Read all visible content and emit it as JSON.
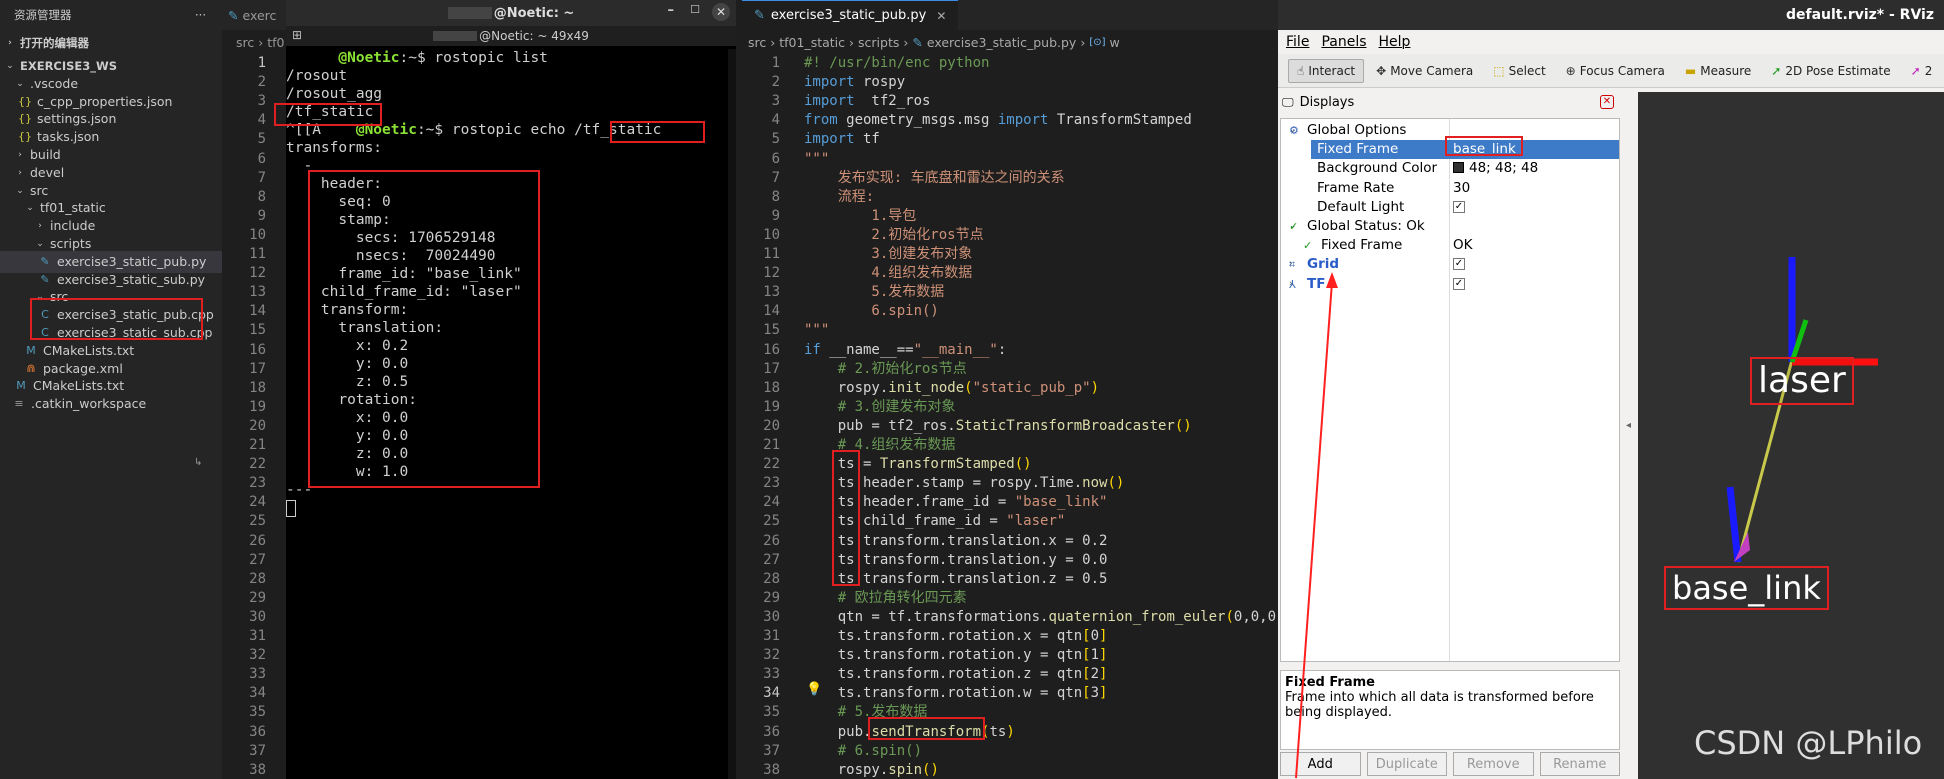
{
  "explorer": {
    "title": "资源管理器",
    "more": "···",
    "open_editors": "打开的编辑器",
    "items": [
      {
        "label": "EXERCISE3_WS",
        "chev": "⌄",
        "icon": "",
        "bold": true
      },
      {
        "label": ".vscode",
        "chev": "⌄",
        "icon": ""
      },
      {
        "label": "c_cpp_properties.json",
        "chev": "",
        "icon": "{}"
      },
      {
        "label": "settings.json",
        "chev": "",
        "icon": "{}"
      },
      {
        "label": "tasks.json",
        "chev": "",
        "icon": "{}"
      },
      {
        "label": "build",
        "chev": "›",
        "icon": ""
      },
      {
        "label": "devel",
        "chev": "›",
        "icon": ""
      },
      {
        "label": "src",
        "chev": "⌄",
        "icon": ""
      },
      {
        "label": "tf01_static",
        "chev": "⌄",
        "icon": ""
      },
      {
        "label": "include",
        "chev": "›",
        "icon": ""
      },
      {
        "label": "scripts",
        "chev": "⌄",
        "icon": ""
      },
      {
        "label": "exercise3_static_pub.py",
        "chev": "",
        "icon": "py",
        "selected": true
      },
      {
        "label": "exercise3_static_sub.py",
        "chev": "",
        "icon": "py"
      },
      {
        "label": "src",
        "chev": "⌄",
        "icon": ""
      },
      {
        "label": "exercise3_static_pub.cpp",
        "chev": "",
        "icon": "C"
      },
      {
        "label": "exercise3_static_sub.cpp",
        "chev": "",
        "icon": "C"
      },
      {
        "label": "CMakeLists.txt",
        "chev": "",
        "icon": "M"
      },
      {
        "label": "package.xml",
        "chev": "",
        "icon": "rss"
      },
      {
        "label": "CMakeLists.txt",
        "chev": "",
        "icon": "M"
      },
      {
        "label": ".catkin_workspace",
        "chev": "",
        "icon": "≡"
      }
    ]
  },
  "left_editor": {
    "tab": "exerc",
    "crumbs": "src › tf0",
    "line_numbers": [
      "1",
      "2",
      "3",
      "4",
      "5",
      "6",
      "7",
      "8",
      "9",
      "10",
      "11",
      "12",
      "13",
      "14",
      "15",
      "16",
      "17",
      "18",
      "19",
      "20",
      "21",
      "22",
      "23",
      "24",
      "25",
      "26",
      "27",
      "28",
      "29",
      "30",
      "31",
      "32",
      "33",
      "34",
      "35",
      "36",
      "37",
      "38"
    ]
  },
  "terminal": {
    "title": "@Noetic: ~",
    "subtitle": "@Noetic: ~ 49x49",
    "lines": [
      {
        "prompt": "@Noetic",
        "rest": ":~$ rostopic list"
      },
      {
        "text": "/rosout"
      },
      {
        "text": "/rosout_agg"
      },
      {
        "text": "/tf_static"
      },
      {
        "prefix": "^[[A    ",
        "prompt": "@Noetic",
        "rest": ":~$ rostopic echo /tf_static"
      },
      {
        "text": "transforms:"
      },
      {
        "text": "  -"
      },
      {
        "text": "    header:"
      },
      {
        "text": "      seq: 0"
      },
      {
        "text": "      stamp:"
      },
      {
        "text": "        secs: 1706529148"
      },
      {
        "text": "        nsecs:  70024490"
      },
      {
        "text": "      frame_id: \"base_link\""
      },
      {
        "text": "    child_frame_id: \"laser\""
      },
      {
        "text": "    transform:"
      },
      {
        "text": "      translation:"
      },
      {
        "text": "        x: 0.2"
      },
      {
        "text": "        y: 0.0"
      },
      {
        "text": "        z: 0.5"
      },
      {
        "text": "      rotation:"
      },
      {
        "text": "        x: 0.0"
      },
      {
        "text": "        y: 0.0"
      },
      {
        "text": "        z: 0.0"
      },
      {
        "text": "        w: 1.0"
      },
      {
        "text": "---"
      }
    ]
  },
  "editor": {
    "tab": "exercise3_static_pub.py",
    "breadcrumbs": [
      "src",
      "tf01_static",
      "scripts",
      "exercise3_static_pub.py",
      "w"
    ],
    "current_line": 34,
    "lines": [
      [
        [
          "cm",
          "#! /usr/bin/enc python"
        ]
      ],
      [
        [
          "kw",
          "import"
        ],
        [
          "tx",
          " rospy"
        ]
      ],
      [
        [
          "kw",
          "import"
        ],
        [
          "tx",
          "  tf2_ros"
        ]
      ],
      [
        [
          "kw",
          "from"
        ],
        [
          "tx",
          " geometry_msgs.msg "
        ],
        [
          "kw",
          "import"
        ],
        [
          "tx",
          " TransformStamped"
        ]
      ],
      [
        [
          "kw",
          "import"
        ],
        [
          "tx",
          " tf"
        ]
      ],
      [
        [
          "str",
          "\"\"\""
        ]
      ],
      [
        [
          "str",
          "    发布实现: 车底盘和雷达之间的关系"
        ]
      ],
      [
        [
          "str",
          "    流程:"
        ]
      ],
      [
        [
          "str",
          "        1.导包"
        ]
      ],
      [
        [
          "str",
          "        2.初始化ros节点"
        ]
      ],
      [
        [
          "str",
          "        3.创建发布对象"
        ]
      ],
      [
        [
          "str",
          "        4.组织发布数据"
        ]
      ],
      [
        [
          "str",
          "        5.发布数据"
        ]
      ],
      [
        [
          "str",
          "        6.spin()"
        ]
      ],
      [
        [
          "str",
          "\"\"\""
        ]
      ],
      [
        [
          "kw",
          "if"
        ],
        [
          "tx",
          " __name__=="
        ],
        [
          "str",
          "\"__main__\""
        ],
        [
          "tx",
          ":"
        ]
      ],
      [
        [
          "cm",
          "    # 2.初始化ros节点"
        ]
      ],
      [
        [
          "tx",
          "    rospy."
        ],
        [
          "fn",
          "init_node"
        ],
        [
          "pr",
          "("
        ],
        [
          "str",
          "\"static_pub_p\""
        ],
        [
          "pr",
          ")"
        ]
      ],
      [
        [
          "cm",
          "    # 3.创建发布对象"
        ]
      ],
      [
        [
          "tx",
          "    pub = tf2_ros."
        ],
        [
          "fn",
          "StaticTransformBroadcaster"
        ],
        [
          "pr",
          "()"
        ]
      ],
      [
        [
          "cm",
          "    # 4.组织发布数据"
        ]
      ],
      [
        [
          "tx",
          "    ts = "
        ],
        [
          "fn",
          "TransformStamped"
        ],
        [
          "pr",
          "()"
        ]
      ],
      [
        [
          "tx",
          "    ts.header.stamp = rospy.Time."
        ],
        [
          "fn",
          "now"
        ],
        [
          "pr",
          "()"
        ]
      ],
      [
        [
          "tx",
          "    ts.header.frame_id = "
        ],
        [
          "str",
          "\"base_link\""
        ]
      ],
      [
        [
          "tx",
          "    ts.child_frame_id = "
        ],
        [
          "str",
          "\"laser\""
        ]
      ],
      [
        [
          "tx",
          "    ts.transform.translation.x = 0.2"
        ]
      ],
      [
        [
          "tx",
          "    ts.transform.translation.y = 0.0"
        ]
      ],
      [
        [
          "tx",
          "    ts.transform.translation.z = 0.5"
        ]
      ],
      [
        [
          "cm",
          "    # 欧拉角转化四元素"
        ]
      ],
      [
        [
          "tx",
          "    qtn = tf.transformations."
        ],
        [
          "fn",
          "quaternion_from_euler"
        ],
        [
          "pr",
          "("
        ],
        [
          "tx",
          "0,0,0"
        ]
      ],
      [
        [
          "tx",
          "    ts.transform.rotation.x = qtn"
        ],
        [
          "pr",
          "["
        ],
        [
          "tx",
          "0"
        ],
        [
          "pr",
          "]"
        ]
      ],
      [
        [
          "tx",
          "    ts.transform.rotation.y = qtn"
        ],
        [
          "pr",
          "["
        ],
        [
          "tx",
          "1"
        ],
        [
          "pr",
          "]"
        ]
      ],
      [
        [
          "tx",
          "    ts.transform.rotation.z = qtn"
        ],
        [
          "pr",
          "["
        ],
        [
          "tx",
          "2"
        ],
        [
          "pr",
          "]"
        ]
      ],
      [
        [
          "tx",
          "    ts.transform.rotation.w = qtn"
        ],
        [
          "pr",
          "["
        ],
        [
          "tx",
          "3"
        ],
        [
          "pr",
          "]"
        ]
      ],
      [
        [
          "cm",
          "    # 5.发布数据"
        ]
      ],
      [
        [
          "tx",
          "    pub."
        ],
        [
          "fn",
          "sendTransform"
        ],
        [
          "pr",
          "("
        ],
        [
          "tx",
          "ts"
        ],
        [
          "pr",
          ")"
        ]
      ],
      [
        [
          "cm",
          "    # 6.spin()"
        ]
      ],
      [
        [
          "tx",
          "    rospy."
        ],
        [
          "fn",
          "spin"
        ],
        [
          "pr",
          "()"
        ]
      ]
    ]
  },
  "rviz": {
    "window_title": "default.rviz* - RViz",
    "menu": [
      "File",
      "Panels",
      "Help"
    ],
    "tools": [
      "Interact",
      "Move Camera",
      "Select",
      "Focus Camera",
      "Measure",
      "2D Pose Estimate",
      "2"
    ],
    "displays_title": "Displays",
    "tree": [
      {
        "name": "Global Options",
        "value": "",
        "indent": 1,
        "chev": "⌄",
        "icon": "gear"
      },
      {
        "name": "Fixed Frame",
        "value": "base_link",
        "indent": 3,
        "selected": true
      },
      {
        "name": "Background Color",
        "value": "48; 48; 48",
        "indent": 3,
        "swatch": true
      },
      {
        "name": "Frame Rate",
        "value": "30",
        "indent": 3
      },
      {
        "name": "Default Light",
        "value": "",
        "indent": 3,
        "check": true
      },
      {
        "name": "Global Status: Ok",
        "value": "",
        "indent": 1,
        "chev": "⌄",
        "ok": true
      },
      {
        "name": "Fixed Frame",
        "value": "OK",
        "indent": 2,
        "ok": true
      },
      {
        "name": "Grid",
        "value": "",
        "indent": 1,
        "chev": "›",
        "check": true,
        "blue": true,
        "icon": "grid"
      },
      {
        "name": "TF",
        "value": "",
        "indent": 1,
        "chev": "›",
        "check": true,
        "blue": true,
        "icon": "tf"
      }
    ],
    "help_title": "Fixed Frame",
    "help_text": "Frame into which all data is transformed before being displayed.",
    "buttons": [
      "Add",
      "Duplicate",
      "Remove",
      "Rename"
    ],
    "frame_labels": {
      "laser": "laser",
      "base": "base_link"
    },
    "bg_color": "#303030"
  },
  "watermark": "CSDN @LPhilo"
}
